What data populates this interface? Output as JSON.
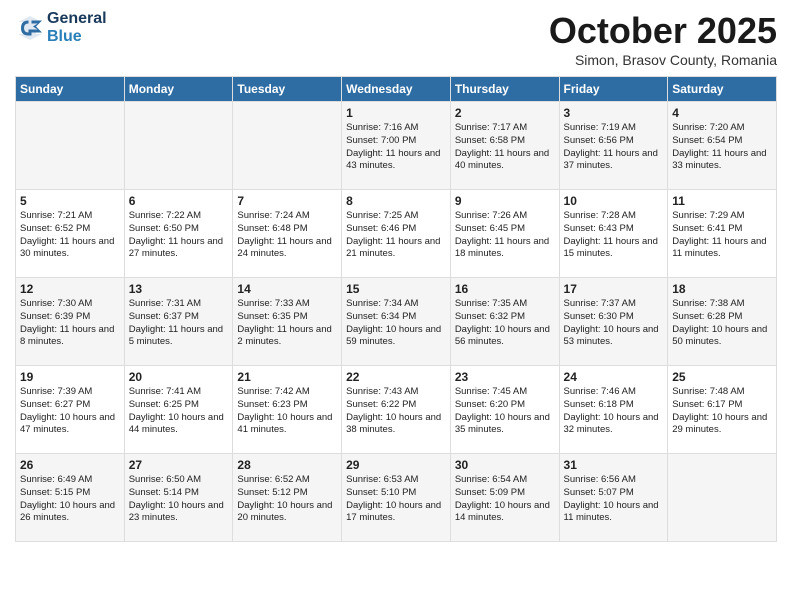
{
  "header": {
    "logo_line1": "General",
    "logo_line2": "Blue",
    "month": "October 2025",
    "location": "Simon, Brasov County, Romania"
  },
  "days_of_week": [
    "Sunday",
    "Monday",
    "Tuesday",
    "Wednesday",
    "Thursday",
    "Friday",
    "Saturday"
  ],
  "weeks": [
    [
      {
        "day": "",
        "info": ""
      },
      {
        "day": "",
        "info": ""
      },
      {
        "day": "",
        "info": ""
      },
      {
        "day": "1",
        "info": "Sunrise: 7:16 AM\nSunset: 7:00 PM\nDaylight: 11 hours\nand 43 minutes."
      },
      {
        "day": "2",
        "info": "Sunrise: 7:17 AM\nSunset: 6:58 PM\nDaylight: 11 hours\nand 40 minutes."
      },
      {
        "day": "3",
        "info": "Sunrise: 7:19 AM\nSunset: 6:56 PM\nDaylight: 11 hours\nand 37 minutes."
      },
      {
        "day": "4",
        "info": "Sunrise: 7:20 AM\nSunset: 6:54 PM\nDaylight: 11 hours\nand 33 minutes."
      }
    ],
    [
      {
        "day": "5",
        "info": "Sunrise: 7:21 AM\nSunset: 6:52 PM\nDaylight: 11 hours\nand 30 minutes."
      },
      {
        "day": "6",
        "info": "Sunrise: 7:22 AM\nSunset: 6:50 PM\nDaylight: 11 hours\nand 27 minutes."
      },
      {
        "day": "7",
        "info": "Sunrise: 7:24 AM\nSunset: 6:48 PM\nDaylight: 11 hours\nand 24 minutes."
      },
      {
        "day": "8",
        "info": "Sunrise: 7:25 AM\nSunset: 6:46 PM\nDaylight: 11 hours\nand 21 minutes."
      },
      {
        "day": "9",
        "info": "Sunrise: 7:26 AM\nSunset: 6:45 PM\nDaylight: 11 hours\nand 18 minutes."
      },
      {
        "day": "10",
        "info": "Sunrise: 7:28 AM\nSunset: 6:43 PM\nDaylight: 11 hours\nand 15 minutes."
      },
      {
        "day": "11",
        "info": "Sunrise: 7:29 AM\nSunset: 6:41 PM\nDaylight: 11 hours\nand 11 minutes."
      }
    ],
    [
      {
        "day": "12",
        "info": "Sunrise: 7:30 AM\nSunset: 6:39 PM\nDaylight: 11 hours\nand 8 minutes."
      },
      {
        "day": "13",
        "info": "Sunrise: 7:31 AM\nSunset: 6:37 PM\nDaylight: 11 hours\nand 5 minutes."
      },
      {
        "day": "14",
        "info": "Sunrise: 7:33 AM\nSunset: 6:35 PM\nDaylight: 11 hours\nand 2 minutes."
      },
      {
        "day": "15",
        "info": "Sunrise: 7:34 AM\nSunset: 6:34 PM\nDaylight: 10 hours\nand 59 minutes."
      },
      {
        "day": "16",
        "info": "Sunrise: 7:35 AM\nSunset: 6:32 PM\nDaylight: 10 hours\nand 56 minutes."
      },
      {
        "day": "17",
        "info": "Sunrise: 7:37 AM\nSunset: 6:30 PM\nDaylight: 10 hours\nand 53 minutes."
      },
      {
        "day": "18",
        "info": "Sunrise: 7:38 AM\nSunset: 6:28 PM\nDaylight: 10 hours\nand 50 minutes."
      }
    ],
    [
      {
        "day": "19",
        "info": "Sunrise: 7:39 AM\nSunset: 6:27 PM\nDaylight: 10 hours\nand 47 minutes."
      },
      {
        "day": "20",
        "info": "Sunrise: 7:41 AM\nSunset: 6:25 PM\nDaylight: 10 hours\nand 44 minutes."
      },
      {
        "day": "21",
        "info": "Sunrise: 7:42 AM\nSunset: 6:23 PM\nDaylight: 10 hours\nand 41 minutes."
      },
      {
        "day": "22",
        "info": "Sunrise: 7:43 AM\nSunset: 6:22 PM\nDaylight: 10 hours\nand 38 minutes."
      },
      {
        "day": "23",
        "info": "Sunrise: 7:45 AM\nSunset: 6:20 PM\nDaylight: 10 hours\nand 35 minutes."
      },
      {
        "day": "24",
        "info": "Sunrise: 7:46 AM\nSunset: 6:18 PM\nDaylight: 10 hours\nand 32 minutes."
      },
      {
        "day": "25",
        "info": "Sunrise: 7:48 AM\nSunset: 6:17 PM\nDaylight: 10 hours\nand 29 minutes."
      }
    ],
    [
      {
        "day": "26",
        "info": "Sunrise: 6:49 AM\nSunset: 5:15 PM\nDaylight: 10 hours\nand 26 minutes."
      },
      {
        "day": "27",
        "info": "Sunrise: 6:50 AM\nSunset: 5:14 PM\nDaylight: 10 hours\nand 23 minutes."
      },
      {
        "day": "28",
        "info": "Sunrise: 6:52 AM\nSunset: 5:12 PM\nDaylight: 10 hours\nand 20 minutes."
      },
      {
        "day": "29",
        "info": "Sunrise: 6:53 AM\nSunset: 5:10 PM\nDaylight: 10 hours\nand 17 minutes."
      },
      {
        "day": "30",
        "info": "Sunrise: 6:54 AM\nSunset: 5:09 PM\nDaylight: 10 hours\nand 14 minutes."
      },
      {
        "day": "31",
        "info": "Sunrise: 6:56 AM\nSunset: 5:07 PM\nDaylight: 10 hours\nand 11 minutes."
      },
      {
        "day": "",
        "info": ""
      }
    ]
  ]
}
